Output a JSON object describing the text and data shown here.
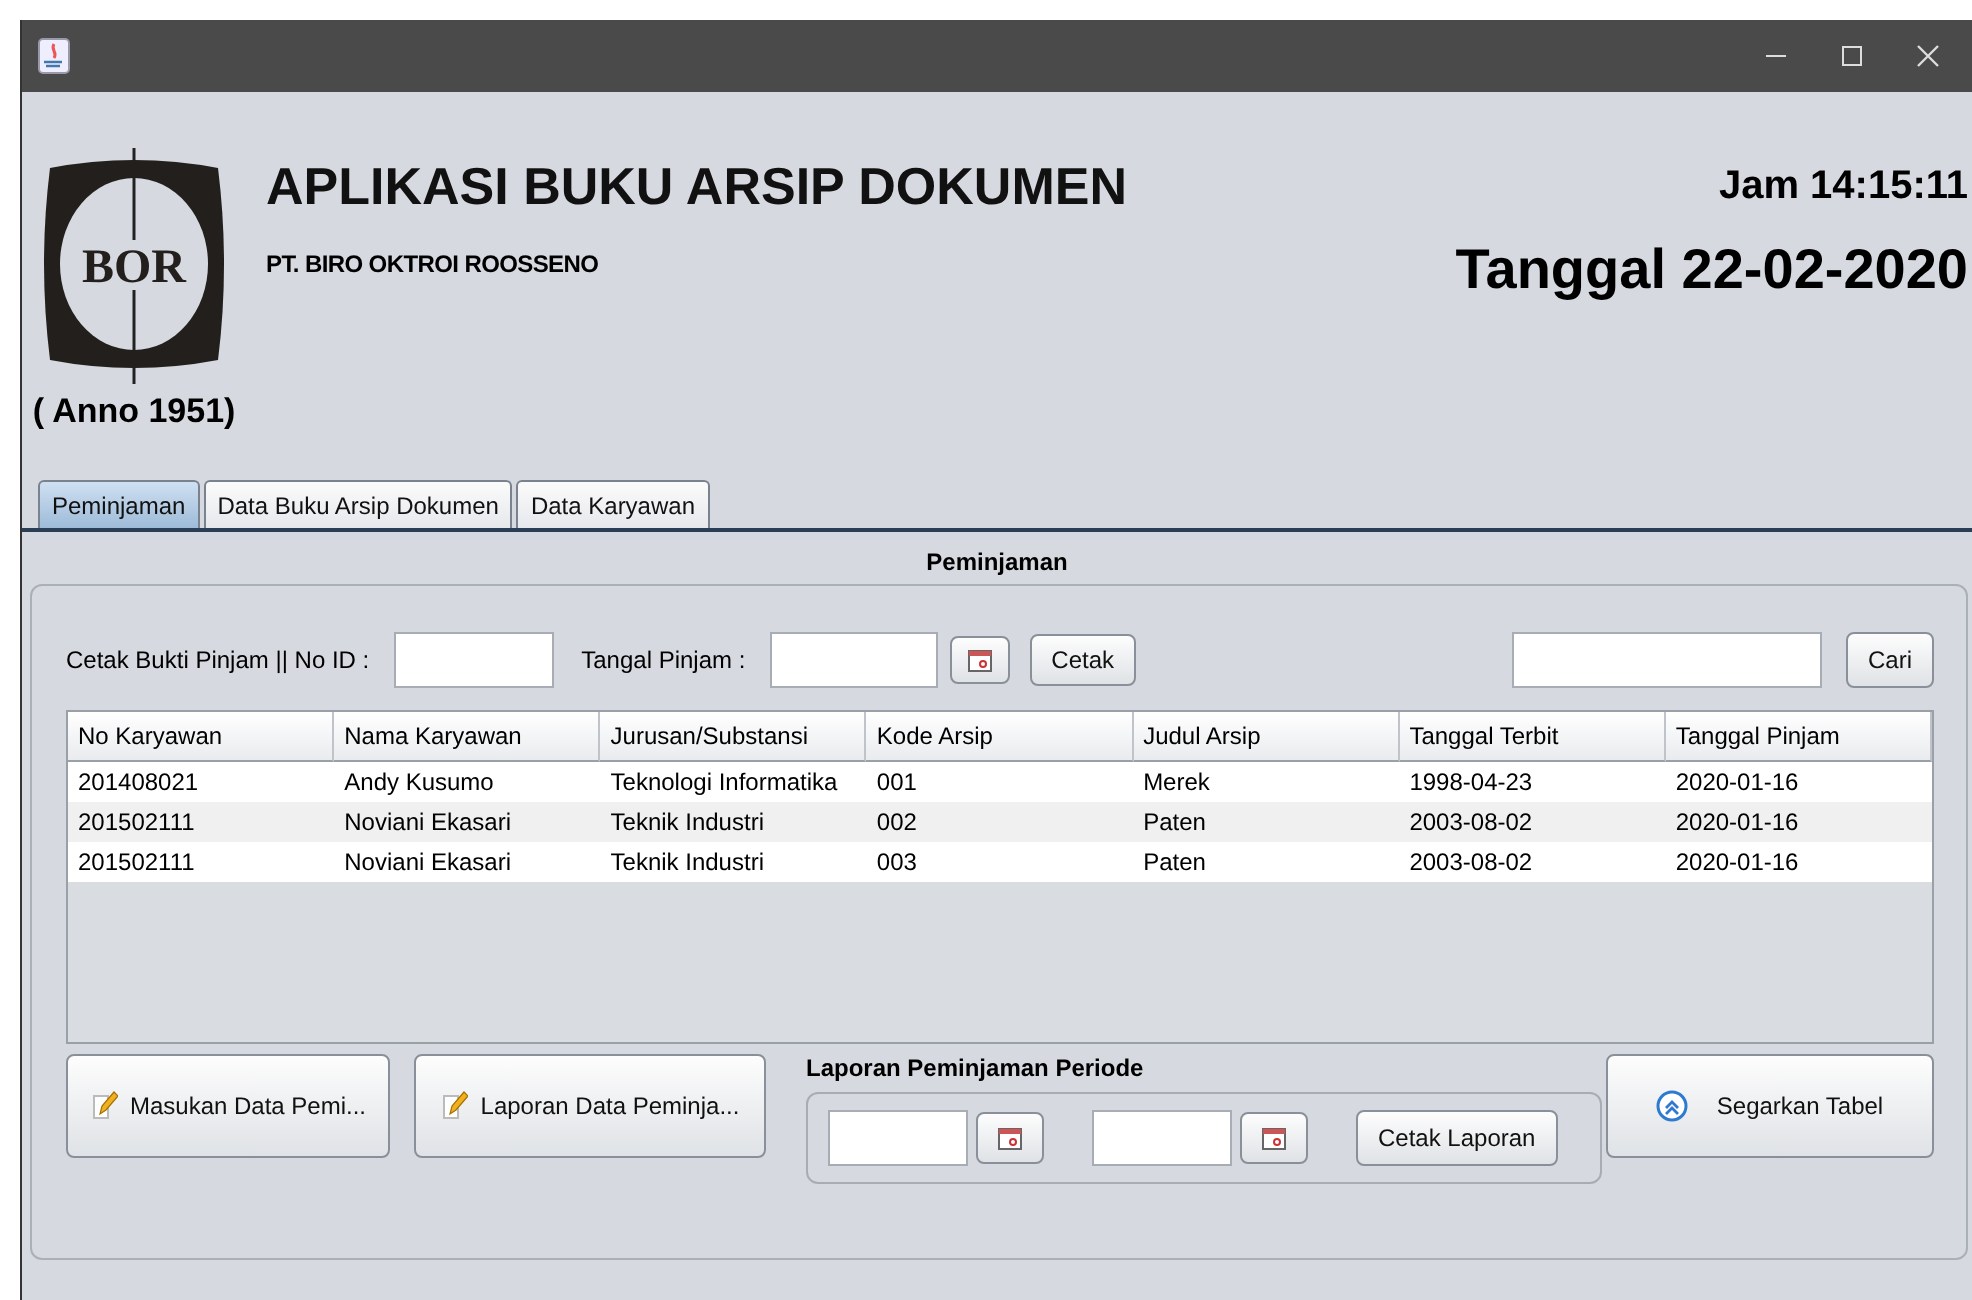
{
  "header": {
    "logo_text": "BOR",
    "anno": "( Anno 1951)",
    "title": "APLIKASI BUKU ARSIP DOKUMEN",
    "subtitle": "PT. BIRO OKTROI ROOSSENO",
    "clock": "Jam 14:15:11",
    "date": "Tanggal 22-02-2020"
  },
  "tabs": [
    {
      "label": "Peminjaman",
      "selected": true
    },
    {
      "label": "Data Buku Arsip Dokumen",
      "selected": false
    },
    {
      "label": "Data Karyawan",
      "selected": false
    }
  ],
  "section_title": "Peminjaman",
  "form": {
    "id_label": "Cetak Bukti Pinjam || No ID :",
    "date_label": "Tangal Pinjam :",
    "print_button": "Cetak",
    "search_button": "Cari"
  },
  "table": {
    "columns": [
      "No Karyawan",
      "Nama Karyawan",
      "Jurusan/Substansi",
      "Kode Arsip",
      "Judul Arsip",
      "Tanggal Terbit",
      "Tanggal Pinjam"
    ],
    "rows": [
      [
        "201408021",
        "Andy Kusumo",
        "Teknologi Informatika",
        "001",
        "Merek",
        "1998-04-23",
        "2020-01-16"
      ],
      [
        "201502111",
        "Noviani Ekasari",
        "Teknik Industri",
        "002",
        "Paten",
        "2003-08-02",
        "2020-01-16"
      ],
      [
        "201502111",
        "Noviani Ekasari",
        "Teknik Industri",
        "003",
        "Paten",
        "2003-08-02",
        "2020-01-16"
      ]
    ]
  },
  "actions": [
    {
      "label": "Masukan Data Pemi...",
      "kind": "pencil"
    },
    {
      "label": "Laporan Data Peminja...",
      "kind": "pencil"
    }
  ],
  "period": {
    "title": "Laporan Peminjaman Periode",
    "button": "Cetak Laporan"
  },
  "refresh": {
    "label": "Segarkan Tabel",
    "kind": "refresh"
  }
}
